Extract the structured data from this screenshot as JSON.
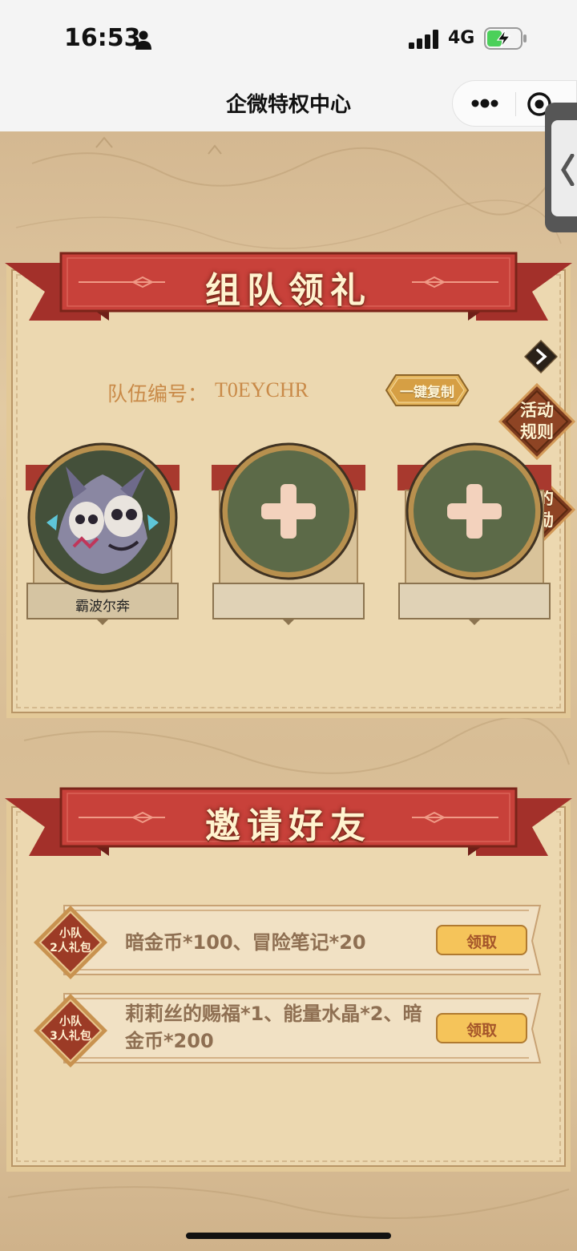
{
  "status_bar": {
    "time": "16:53",
    "network": "4G"
  },
  "nav": {
    "title": "企微特权中心"
  },
  "team_section": {
    "title": "组队领礼",
    "team_id_label": "队伍编号：",
    "team_id_value": "T0EYCHR",
    "copy_button": "一键复制",
    "rules_button": [
      "活动",
      "规则"
    ],
    "rewards_button": [
      "我的",
      "奖励"
    ],
    "members": [
      {
        "name": "霸波尔奔",
        "filled": true
      },
      {
        "name": "",
        "filled": false
      },
      {
        "name": "",
        "filled": false
      }
    ]
  },
  "invite_section": {
    "title": "邀请好友",
    "rewards": [
      {
        "badge": [
          "小队",
          "2人礼包"
        ],
        "text": "暗金币*100、冒险笔记*20",
        "button": "领取"
      },
      {
        "badge": [
          "小队",
          "3人礼包"
        ],
        "text": "莉莉丝的赐福*1、能量水晶*2、暗金币*200",
        "button": "领取"
      }
    ]
  },
  "colors": {
    "ribbon_red": "#c8413a",
    "panel_bg": "#ecd8b0",
    "slot_green": "#5c6a48",
    "accent_orange": "#c98a48",
    "button_gold": "#f5c45a"
  }
}
